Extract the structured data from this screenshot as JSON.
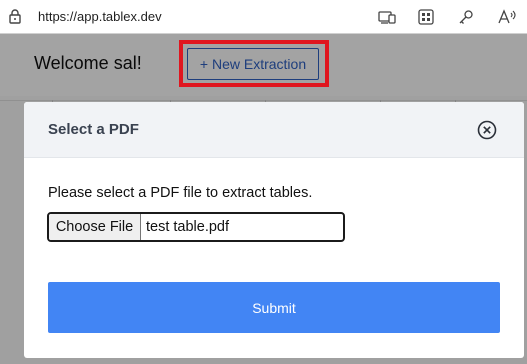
{
  "browser": {
    "url": "https://app.tablex.dev",
    "toolbar_icons": [
      "device-icon",
      "apps-icon",
      "key-icon",
      "read-aloud-icon"
    ]
  },
  "page": {
    "welcome": "Welcome sal!",
    "new_extraction_label": "+ New Extraction"
  },
  "modal": {
    "title": "Select a PDF",
    "instructions": "Please select a PDF file to extract tables.",
    "choose_file_label": "Choose File",
    "selected_file": "test table.pdf",
    "submit_label": "Submit"
  },
  "colors": {
    "primary": "#4285f4",
    "header_bg": "#f1f3f6",
    "highlight": "#e0161f",
    "link_blue": "#2f62c4"
  }
}
